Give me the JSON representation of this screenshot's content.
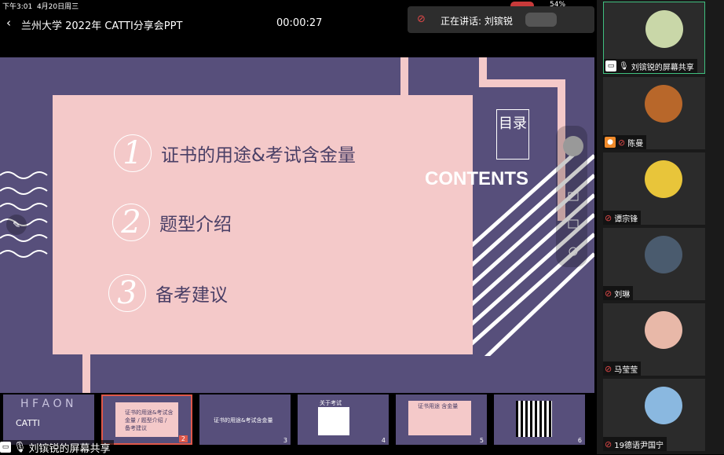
{
  "status_bar": {
    "time": "下午3:01",
    "date": "4月20日周三",
    "battery": "54%"
  },
  "header": {
    "back_icon": "chevron-left-icon",
    "title": "兰州大学 2022年 CATTI分享会PPT",
    "timer": "00:00:27"
  },
  "speaking": {
    "label": "正在讲话: 刘镔锐"
  },
  "slide": {
    "toc_title": "目录",
    "contents_label": "CONTENTS",
    "items": [
      {
        "num": "1",
        "label": "证书的用途&考试含金量"
      },
      {
        "num": "2",
        "label": "题型介绍"
      },
      {
        "num": "3",
        "label": "备考建议"
      }
    ]
  },
  "thumbnails": [
    {
      "num": "",
      "caption": "CATTI",
      "logo": "H F A O N"
    },
    {
      "num": "2",
      "caption": "证书的用途&考试含金量 / 题型介绍 / 备考建议"
    },
    {
      "num": "3",
      "caption": "证书的用途&考试含金量"
    },
    {
      "num": "4",
      "caption": "关于考试"
    },
    {
      "num": "5",
      "caption": "证书用途 含金量"
    },
    {
      "num": "6",
      "caption": ""
    }
  ],
  "share_label": "刘镔锐的屏幕共享",
  "participants": [
    {
      "name": "刘镔锐的屏幕共享",
      "color": "#c9d7a8",
      "active": true
    },
    {
      "name": "陈曼",
      "color": "#b8672a",
      "active": false
    },
    {
      "name": "谭宗锋",
      "color": "#e8c53a",
      "active": false
    },
    {
      "name": "刘琳",
      "color": "#4a5b6e",
      "active": false
    },
    {
      "name": "马莹莹",
      "color": "#e8b8a8",
      "active": false
    },
    {
      "name": "19德语尹国宁",
      "color": "#8ab8e0",
      "active": false
    }
  ]
}
